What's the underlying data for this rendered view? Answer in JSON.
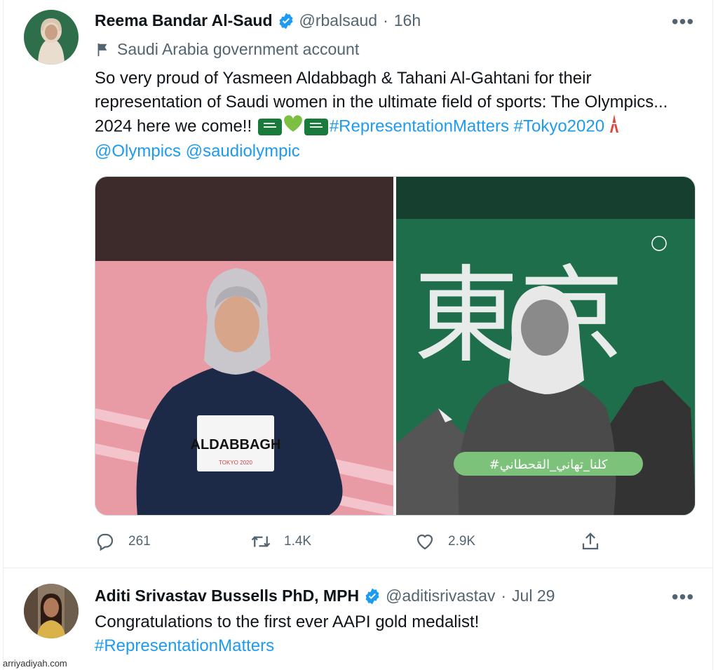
{
  "tweets": [
    {
      "author_name": "Reema Bandar Al-Saud",
      "handle": "@rbalsaud",
      "separator": "·",
      "time": "16h",
      "label": "Saudi Arabia government account",
      "text_plain": "So very proud of Yasmeen Aldabbagh & Tahani Al-Gahtani  for their representation of Saudi women in the ultimate field of sports: The Olympics... 2024 here we come!!",
      "hashtag_1": "#RepresentationMatters",
      "hashtag_2": "#Tokyo2020",
      "mention_1": "@Olympics",
      "mention_2": "@saudiolympic",
      "media": {
        "left_bib": "ALDABBAGH",
        "left_bib_sub": "TOKYO 2020",
        "right_kanji": "東京",
        "right_banner": "#كلنا_تهاني_القحطاني"
      },
      "actions": {
        "reply_count": "261",
        "retweet_count": "1.4K",
        "like_count": "2.9K"
      }
    },
    {
      "author_name": "Aditi Srivastav Bussells PhD, MPH",
      "handle": "@aditisrivastav",
      "separator": "·",
      "time": "Jul 29",
      "text_plain": "Congratulations to the first ever AAPI gold medalist!",
      "hashtag_1": "#RepresentationMatters"
    }
  ],
  "watermark": "arriyadiyah.com",
  "more_label": "•••",
  "colors": {
    "link": "#1d9bf0",
    "secondary_text": "#536471",
    "verified": "#1d9bf0",
    "border": "#e6ecf0"
  },
  "icons": [
    "verified-badge-icon",
    "flag-icon",
    "more-icon",
    "reply-icon",
    "retweet-icon",
    "like-icon",
    "share-icon",
    "green-heart-icon",
    "saudi-flag-icon",
    "tokyo-tower-icon"
  ]
}
